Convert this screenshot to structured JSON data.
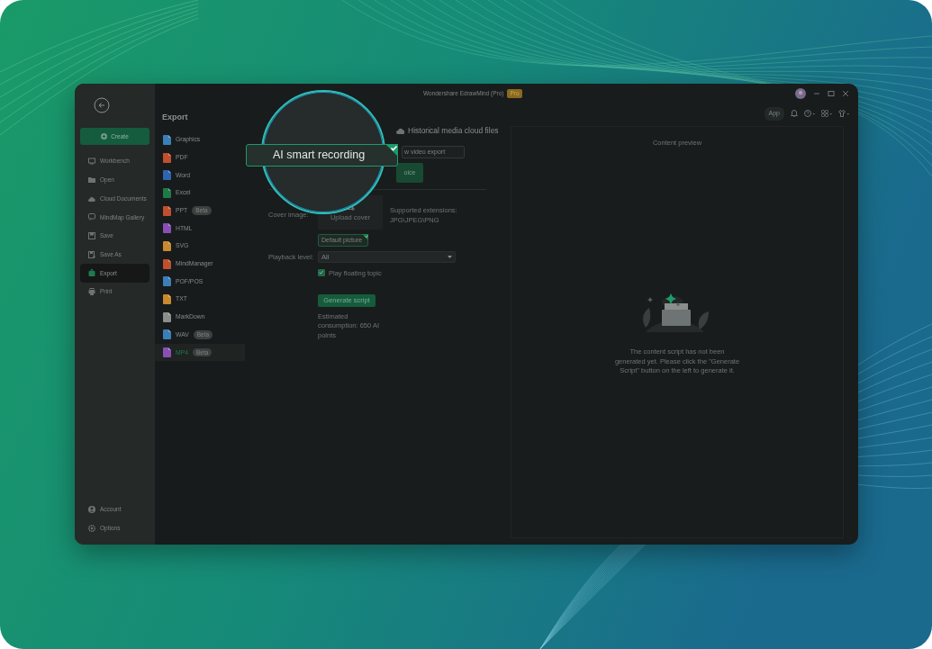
{
  "window": {
    "title": "Wondershare EdrawMind (Pro)",
    "badge": "Pro"
  },
  "sidebar": {
    "create_button": "Create",
    "items": [
      {
        "label": "Workbench",
        "selected": false
      },
      {
        "label": "Open",
        "selected": false
      },
      {
        "label": "Cloud Documents",
        "selected": false
      },
      {
        "label": "MindMap Gallery",
        "selected": false
      },
      {
        "label": "Save",
        "selected": false
      },
      {
        "label": "Save As",
        "selected": false
      },
      {
        "label": "Export",
        "selected": true
      },
      {
        "label": "Print",
        "selected": false
      }
    ],
    "bottom_items": [
      {
        "label": "Account"
      },
      {
        "label": "Options"
      }
    ]
  },
  "export_panel": {
    "heading": "Export",
    "formats": [
      {
        "label": "Graphics",
        "color": "#3a7fb8",
        "selected": false
      },
      {
        "label": "PDF",
        "color": "#c0502e",
        "selected": false
      },
      {
        "label": "Word",
        "color": "#2f64b0",
        "selected": false
      },
      {
        "label": "Excel",
        "color": "#1f7a4a",
        "selected": false
      },
      {
        "label": "PPT",
        "badge": "Beta",
        "color": "#c0502e",
        "selected": false
      },
      {
        "label": "HTML",
        "color": "#8a4fb5",
        "selected": false
      },
      {
        "label": "SVG",
        "color": "#c9892e",
        "selected": false
      },
      {
        "label": "MindManager",
        "color": "#c0502e",
        "selected": false
      },
      {
        "label": "POF/POS",
        "color": "#3a7fb8",
        "selected": false
      },
      {
        "label": "TXT",
        "color": "#c9892e",
        "selected": false
      },
      {
        "label": "MarkDown",
        "color": "#8a8f8e",
        "selected": false
      },
      {
        "label": "WAV",
        "badge": "Beta",
        "color": "#3a7fb8",
        "selected": false
      },
      {
        "label": "MP4",
        "badge": "Beta",
        "color": "#8a4fb5",
        "selected": true
      }
    ]
  },
  "toolbar": {
    "app_button": "App"
  },
  "settings": {
    "magnifier": {
      "label": "AI smart recording",
      "selected": true
    },
    "tabs": [
      {
        "label": "Historical media cloud files",
        "selected": false
      }
    ],
    "export_button": "w video export",
    "voice_button": "oice",
    "cover": {
      "label": "Cover image:",
      "upload": "Upload cover",
      "hint": "Supported extensions: JPG\\JPEG\\PNG"
    },
    "default_picture": {
      "label": "Default picture",
      "selected": true
    },
    "playback": {
      "label": "Playback level:",
      "value": "All"
    },
    "floating_topic": {
      "label": "Play floating topic",
      "checked": true
    },
    "generate_button": "Generate script",
    "estimate": "Estimated consumption: 650 AI points"
  },
  "preview": {
    "title": "Content preview",
    "message": "The content script has not been generated yet. Please click the \"Generate Script\" button on the left to generate it."
  }
}
